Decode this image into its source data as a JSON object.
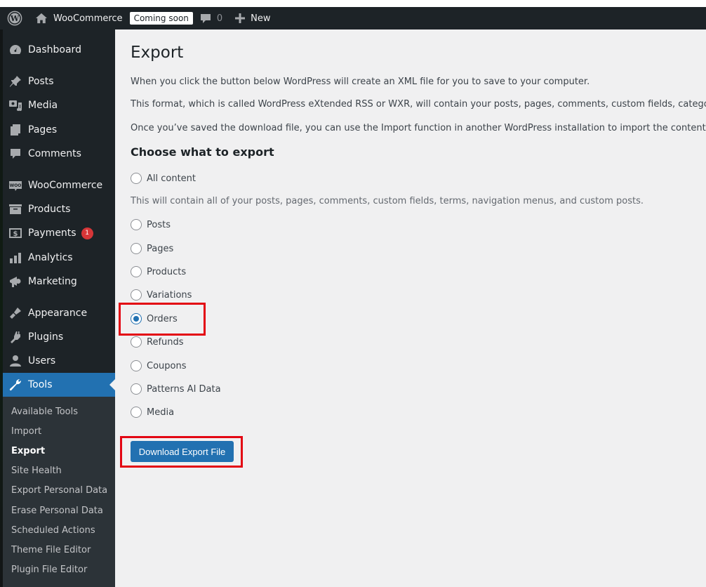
{
  "adminbar": {
    "site_name": "WooCommerce",
    "status_badge": "Coming soon",
    "comment_count": "0",
    "new_label": "New",
    "icons": {
      "logo": "wordpress-logo-icon",
      "home": "home-icon",
      "comments": "comment-bubble-icon",
      "new": "plus-icon"
    }
  },
  "sidebar": {
    "items": [
      {
        "label": "Dashboard",
        "icon": "dashboard-gauge-icon"
      },
      {
        "label": "Posts",
        "icon": "pushpin-icon"
      },
      {
        "label": "Media",
        "icon": "media-camera-music-icon"
      },
      {
        "label": "Pages",
        "icon": "pages-icon"
      },
      {
        "label": "Comments",
        "icon": "comment-icon"
      },
      {
        "label": "WooCommerce",
        "icon": "woo-icon"
      },
      {
        "label": "Products",
        "icon": "archive-box-icon"
      },
      {
        "label": "Payments",
        "icon": "dollar-card-icon",
        "badge": "1"
      },
      {
        "label": "Analytics",
        "icon": "bar-chart-icon"
      },
      {
        "label": "Marketing",
        "icon": "megaphone-icon"
      },
      {
        "label": "Appearance",
        "icon": "paintbrush-icon"
      },
      {
        "label": "Plugins",
        "icon": "plug-icon"
      },
      {
        "label": "Users",
        "icon": "user-icon"
      },
      {
        "label": "Tools",
        "icon": "wrench-icon",
        "current": true
      }
    ],
    "submenu": [
      {
        "label": "Available Tools"
      },
      {
        "label": "Import"
      },
      {
        "label": "Export",
        "active": true
      },
      {
        "label": "Site Health"
      },
      {
        "label": "Export Personal Data"
      },
      {
        "label": "Erase Personal Data"
      },
      {
        "label": "Scheduled Actions"
      },
      {
        "label": "Theme File Editor"
      },
      {
        "label": "Plugin File Editor"
      }
    ]
  },
  "main": {
    "title": "Export",
    "descriptions": [
      "When you click the button below WordPress will create an XML file for you to save to your computer.",
      "This format, which is called WordPress eXtended RSS or WXR, will contain your posts, pages, comments, custom fields, categories, and tags.",
      "Once you’ve saved the download file, you can use the Import function in another WordPress installation to import the content from this site."
    ],
    "section_title": "Choose what to export",
    "all_content_note": "This will contain all of your posts, pages, comments, custom fields, terms, navigation menus, and custom posts.",
    "options": [
      {
        "label": "All content",
        "checked": false
      },
      {
        "label": "Posts",
        "checked": false
      },
      {
        "label": "Pages",
        "checked": false
      },
      {
        "label": "Products",
        "checked": false
      },
      {
        "label": "Variations",
        "checked": false
      },
      {
        "label": "Orders",
        "checked": true
      },
      {
        "label": "Refunds",
        "checked": false
      },
      {
        "label": "Coupons",
        "checked": false
      },
      {
        "label": "Patterns AI Data",
        "checked": false
      },
      {
        "label": "Media",
        "checked": false
      }
    ],
    "download_button": "Download Export File"
  },
  "colors": {
    "accent": "#2271b1",
    "admin_bg": "#1d2327",
    "submenu_bg": "#2c3338",
    "content_bg": "#f0f0f1",
    "badge": "#d63638",
    "annotation_red": "#e30613"
  }
}
